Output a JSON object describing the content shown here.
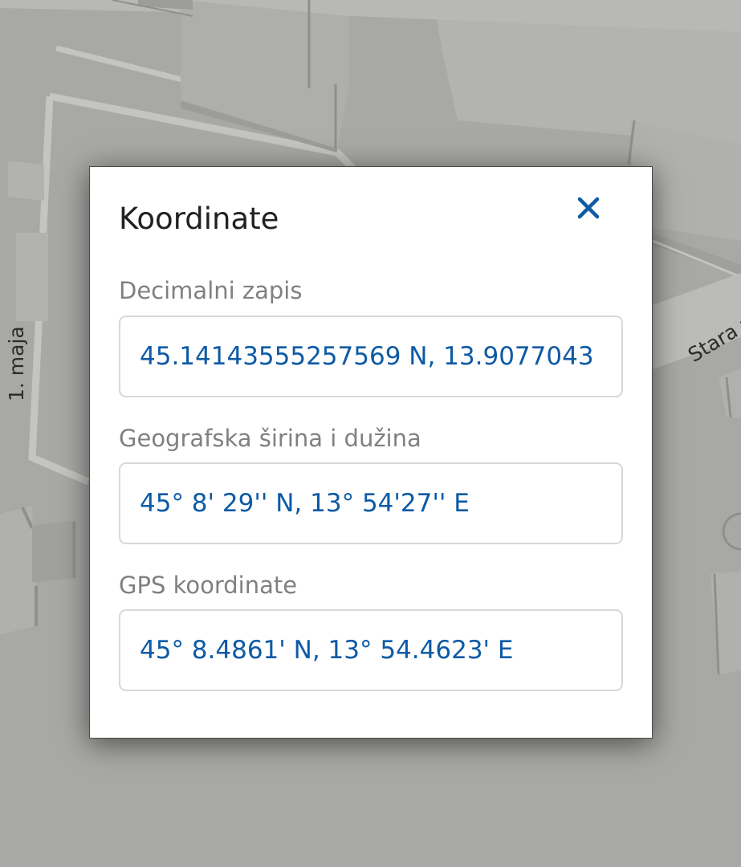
{
  "map": {
    "street_labels": [
      "1. maja",
      "Stara v"
    ]
  },
  "dialog": {
    "title": "Koordinate",
    "close_icon": "close-icon",
    "accent_color": "#0d5aa6",
    "fields": [
      {
        "label": "Decimalni zapis",
        "value": "45.14143555257569 N, 13.9077043"
      },
      {
        "label": "Geografska širina i dužina",
        "value": "45° 8' 29'' N, 13° 54'27'' E"
      },
      {
        "label": "GPS koordinate",
        "value": "45° 8.4861' N, 13° 54.4623' E"
      }
    ]
  }
}
